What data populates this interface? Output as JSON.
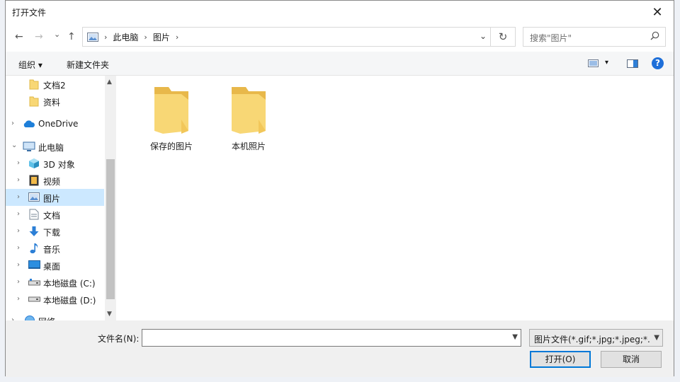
{
  "window": {
    "title": "打开文件",
    "close_glyph": "✕"
  },
  "nav": {
    "back": "←",
    "forward": "→",
    "recent": "⌄",
    "up": "↑"
  },
  "address": {
    "crumbs": [
      "此电脑",
      "图片"
    ],
    "separator": "›",
    "refresh": "↻",
    "dropdown": "⌄"
  },
  "search": {
    "placeholder": "搜索\"图片\"",
    "icon": "search-icon"
  },
  "toolbar": {
    "organize": "组织 ▾",
    "new_folder": "新建文件夹",
    "view_menu": "▾",
    "help": "?"
  },
  "sidebar": {
    "items": [
      {
        "label": "文档2",
        "icon": "folder-icon",
        "chevron": ""
      },
      {
        "label": "资料",
        "icon": "folder-icon",
        "chevron": ""
      },
      {
        "label": "OneDrive",
        "icon": "cloud-icon",
        "chevron": "›"
      },
      {
        "label": "此电脑",
        "icon": "computer-icon",
        "chevron": "⌄"
      },
      {
        "label": "3D 对象",
        "icon": "cube-icon",
        "chevron": "›"
      },
      {
        "label": "视频",
        "icon": "film-icon",
        "chevron": "›"
      },
      {
        "label": "图片",
        "icon": "picture-icon",
        "chevron": "›",
        "selected": true
      },
      {
        "label": "文档",
        "icon": "document-icon",
        "chevron": "›"
      },
      {
        "label": "下载",
        "icon": "download-icon",
        "chevron": "›"
      },
      {
        "label": "音乐",
        "icon": "music-icon",
        "chevron": "›"
      },
      {
        "label": "桌面",
        "icon": "desktop-icon",
        "chevron": "›"
      },
      {
        "label": "本地磁盘 (C:)",
        "icon": "drive-icon",
        "chevron": "›"
      },
      {
        "label": "本地磁盘 (D:)",
        "icon": "drive-icon",
        "chevron": "›"
      },
      {
        "label": "网络",
        "icon": "network-icon",
        "chevron": "›"
      }
    ],
    "scroll_up": "▲",
    "scroll_down": "▼"
  },
  "main": {
    "folders": [
      {
        "label": "保存的图片"
      },
      {
        "label": "本机照片"
      }
    ]
  },
  "bottom": {
    "filename_label": "文件名(N):",
    "filename_value": "",
    "filetype": "图片文件(*.gif;*.jpg;*.jpeg;*.",
    "open_label": "打开(O)",
    "cancel_label": "取消"
  },
  "colors": {
    "accent": "#0078d7",
    "selected_bg": "#cce8ff",
    "folder": "#f8d775"
  }
}
